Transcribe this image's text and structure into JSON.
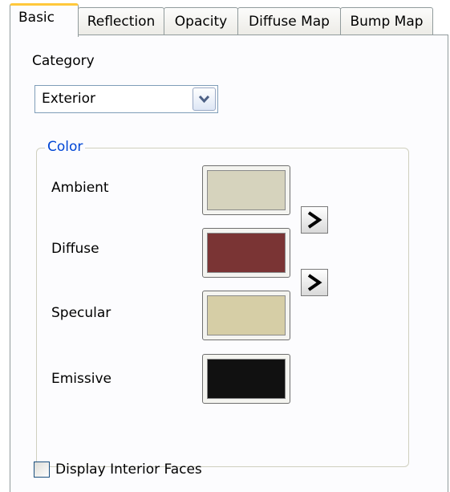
{
  "tabs": [
    {
      "label": "Basic",
      "active": true
    },
    {
      "label": "Reflection",
      "active": false
    },
    {
      "label": "Opacity",
      "active": false
    },
    {
      "label": "Diffuse Map",
      "active": false
    },
    {
      "label": "Bump Map",
      "active": false
    }
  ],
  "category": {
    "label": "Category",
    "selected": "Exterior"
  },
  "color_group": {
    "title": "Color",
    "rows": [
      {
        "label": "Ambient",
        "color": "#d6d3bd"
      },
      {
        "label": "Diffuse",
        "color": "#7a3434"
      },
      {
        "label": "Specular",
        "color": "#d6cea6"
      },
      {
        "label": "Emissive",
        "color": "#111111"
      }
    ],
    "copy_icon": "bent-arrow-icon"
  },
  "display_interior_faces": {
    "label": "Display Interior Faces",
    "checked": false
  },
  "colors": {
    "accent_tab": "#ffc83c",
    "group_title": "#0046d5",
    "border": "#919b9c"
  }
}
